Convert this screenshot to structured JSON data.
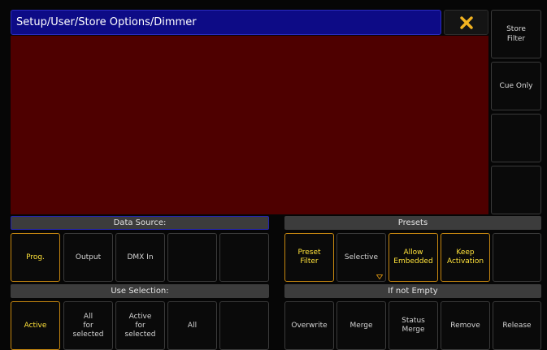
{
  "window": {
    "title": "Setup/User/Store Options/Dimmer",
    "close_icon": "close-x-icon",
    "accent_color": "#f2b320",
    "title_bar_color": "#0d0b86",
    "content_color": "#4e0000"
  },
  "side_buttons": [
    {
      "label": "Store\nFilter"
    },
    {
      "label": "Cue Only"
    },
    {
      "label": ""
    },
    {
      "label": ""
    }
  ],
  "data_source": {
    "header": "Data Source:",
    "buttons": [
      {
        "label": "Prog.",
        "active": true
      },
      {
        "label": "Output",
        "active": false
      },
      {
        "label": "DMX In",
        "active": false
      },
      {
        "label": "",
        "active": false
      },
      {
        "label": "",
        "active": false
      }
    ]
  },
  "presets": {
    "header": "Presets",
    "buttons": [
      {
        "label": "Preset\nFilter",
        "active": true
      },
      {
        "label": "Selective",
        "active": false,
        "has_dropdown": true
      },
      {
        "label": "Allow\nEmbedded",
        "active": true
      },
      {
        "label": "Keep\nActivation",
        "active": true
      },
      {
        "label": "",
        "active": false
      }
    ]
  },
  "use_selection": {
    "header": "Use Selection:",
    "buttons": [
      {
        "label": "Active",
        "active": true
      },
      {
        "label": "All\nfor\nselected",
        "active": false
      },
      {
        "label": "Active\nfor\nselected",
        "active": false
      },
      {
        "label": "All",
        "active": false
      },
      {
        "label": "",
        "active": false
      }
    ]
  },
  "if_not_empty": {
    "header": "If not Empty",
    "buttons": [
      {
        "label": "Overwrite",
        "active": false
      },
      {
        "label": "Merge",
        "active": false
      },
      {
        "label": "Status\nMerge",
        "active": false
      },
      {
        "label": "Remove",
        "active": false
      },
      {
        "label": "Release",
        "active": false
      }
    ]
  }
}
